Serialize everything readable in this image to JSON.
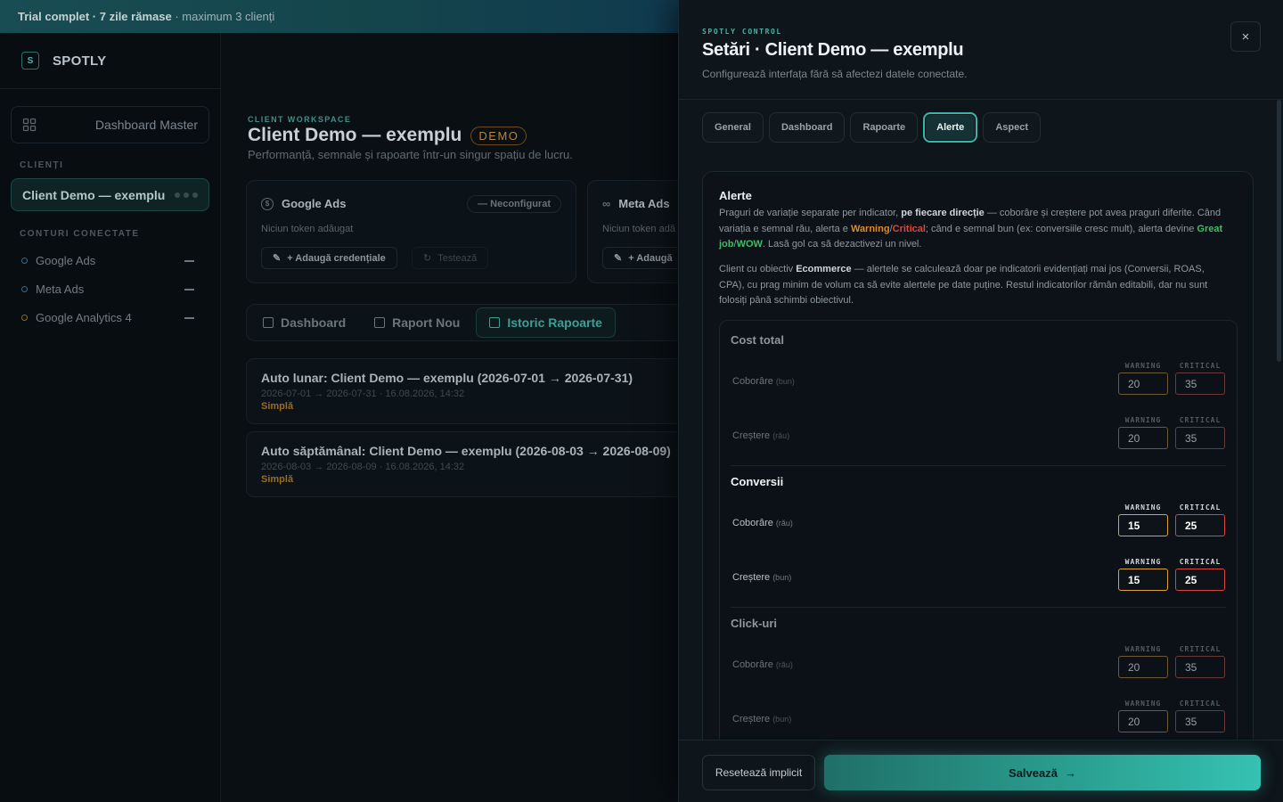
{
  "trial": {
    "bold": "Trial complet · 7 zile rămase",
    "rest": " · maximum 3 clienți"
  },
  "brand": {
    "logo": "S",
    "name": "SPOTLY"
  },
  "sidebar": {
    "dashboard_master": "Dashboard Master",
    "clients_label": "CLIENȚI",
    "active_client": "Client Demo — exemplu",
    "accounts_label": "CONTURI CONECTATE",
    "accounts": [
      "Google Ads",
      "Meta Ads",
      "Google Analytics 4"
    ]
  },
  "main": {
    "workspace_label": "CLIENT WORKSPACE",
    "title": "Client Demo — exemplu",
    "badge": "DEMO",
    "subtitle": "Performanță, semnale și rapoarte într-un singur spațiu de lucru.",
    "cards": [
      {
        "name": "Google Ads",
        "status": "— Neconfigurat",
        "note": "Niciun token adăugat",
        "add": "+ Adaugă credențiale",
        "test": "Testează"
      },
      {
        "name": "Meta Ads",
        "note": "Niciun token adă",
        "add": "+ Adaugă"
      }
    ],
    "tabs": [
      "Dashboard",
      "Raport Nou",
      "Istoric Rapoarte"
    ],
    "reports": [
      {
        "title": "Auto lunar: Client Demo — exemplu (2026-07-01 → 2026-07-31)",
        "dates": "2026-07-01 → 2026-07-31 · 16.08.2026, 14:32",
        "type": "Simplă"
      },
      {
        "title": "Auto săptămânal: Client Demo — exemplu (2026-08-03 → 2026-08-09)",
        "dates": "2026-08-03 → 2026-08-09 · 16.08.2026, 14:32",
        "type": "Simplă"
      }
    ]
  },
  "panel": {
    "kicker": "SPOTLY CONTROL",
    "title": "Setări · Client Demo — exemplu",
    "subtitle": "Configurează interfața fără să afectezi datele conectate.",
    "close": "×",
    "tabs": [
      "General",
      "Dashboard",
      "Rapoarte",
      "Alerte",
      "Aspect"
    ],
    "active_tab": "Alerte",
    "alerts": {
      "title": "Alerte",
      "p1": {
        "a": "Praguri de variație separate per indicator, ",
        "b": "pe fiecare direcție",
        "c": " — coborâre și creștere pot avea praguri diferite. Când variația e semnal rău, alerta e ",
        "warn": "Warning",
        "slash1": "/",
        "crit": "Critical",
        "d": "; când e semnal bun (ex: conversiile cresc mult), alerta devine ",
        "good": "Great job",
        "slash2": "/",
        "wow": "WOW",
        "e": ". Lasă gol ca să dezactivezi un nivel."
      },
      "p2": {
        "a": "Client cu obiectiv ",
        "b": "Ecommerce",
        "c": " — alertele se calculează doar pe indicatorii evidențiați mai jos (Conversii, ROAS, CPA), cu prag minim de volum ca să evite alertele pe date puține. Restul indicatorilor rămân editabili, dar nu sunt folosiți până schimbi obiectivul."
      },
      "warning_label": "WARNING",
      "critical_label": "CRITICAL",
      "metrics": [
        {
          "name": "Cost total",
          "rows": [
            {
              "label": "Coborâre",
              "hint": "(bun)",
              "warning": "20",
              "critical": "35"
            },
            {
              "label": "Creștere",
              "hint": "(rău)",
              "warning": "20",
              "critical": "35"
            }
          ]
        },
        {
          "name": "Conversii",
          "rows": [
            {
              "label": "Coborâre",
              "hint": "(rău)",
              "warning": "15",
              "critical": "25"
            },
            {
              "label": "Creștere",
              "hint": "(bun)",
              "warning": "15",
              "critical": "25"
            }
          ]
        },
        {
          "name": "Click-uri",
          "rows": [
            {
              "label": "Coborâre",
              "hint": "(rău)",
              "warning": "20",
              "critical": "35"
            },
            {
              "label": "Creștere",
              "hint": "(bun)",
              "warning": "20",
              "critical": "35"
            }
          ]
        }
      ]
    },
    "footer": {
      "reset": "Resetează implicit",
      "save": "Salvează",
      "save_arrow": "→"
    }
  },
  "colors": {
    "accent": "#35c2b2",
    "warning": "#e0a234",
    "critical": "#d9453a",
    "good": "#3fbd64"
  }
}
